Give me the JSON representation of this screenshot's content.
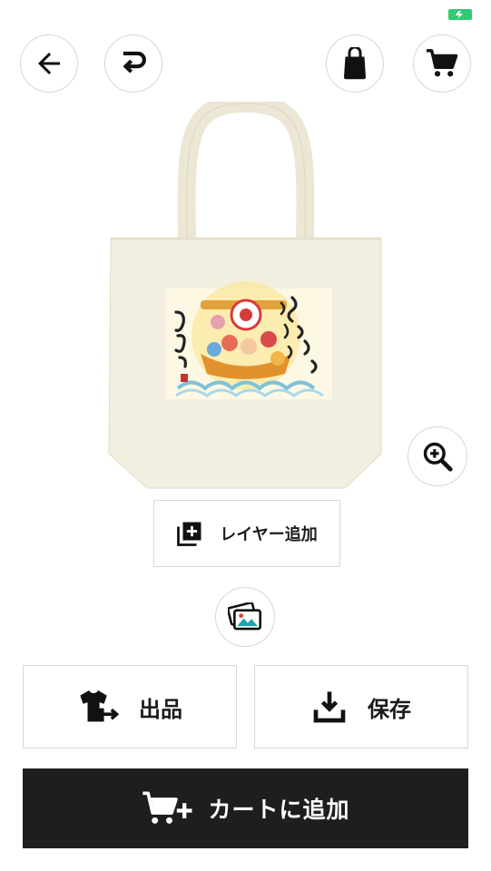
{
  "status": {
    "battery_color": "#2ecc71"
  },
  "toolbar": {
    "back_icon": "arrow-left-icon",
    "redo_icon": "redo-icon",
    "product_icon": "bag-icon",
    "cart_icon": "cart-icon"
  },
  "product": {
    "type": "tote-bag",
    "color": "#f3f0e3"
  },
  "controls": {
    "zoom_icon": "zoom-in-icon",
    "add_layer_label": "レイヤー追加",
    "image_library_icon": "photo-library-icon"
  },
  "actions": {
    "list_label": "出品",
    "save_label": "保存",
    "add_to_cart_label": "カートに追加"
  }
}
